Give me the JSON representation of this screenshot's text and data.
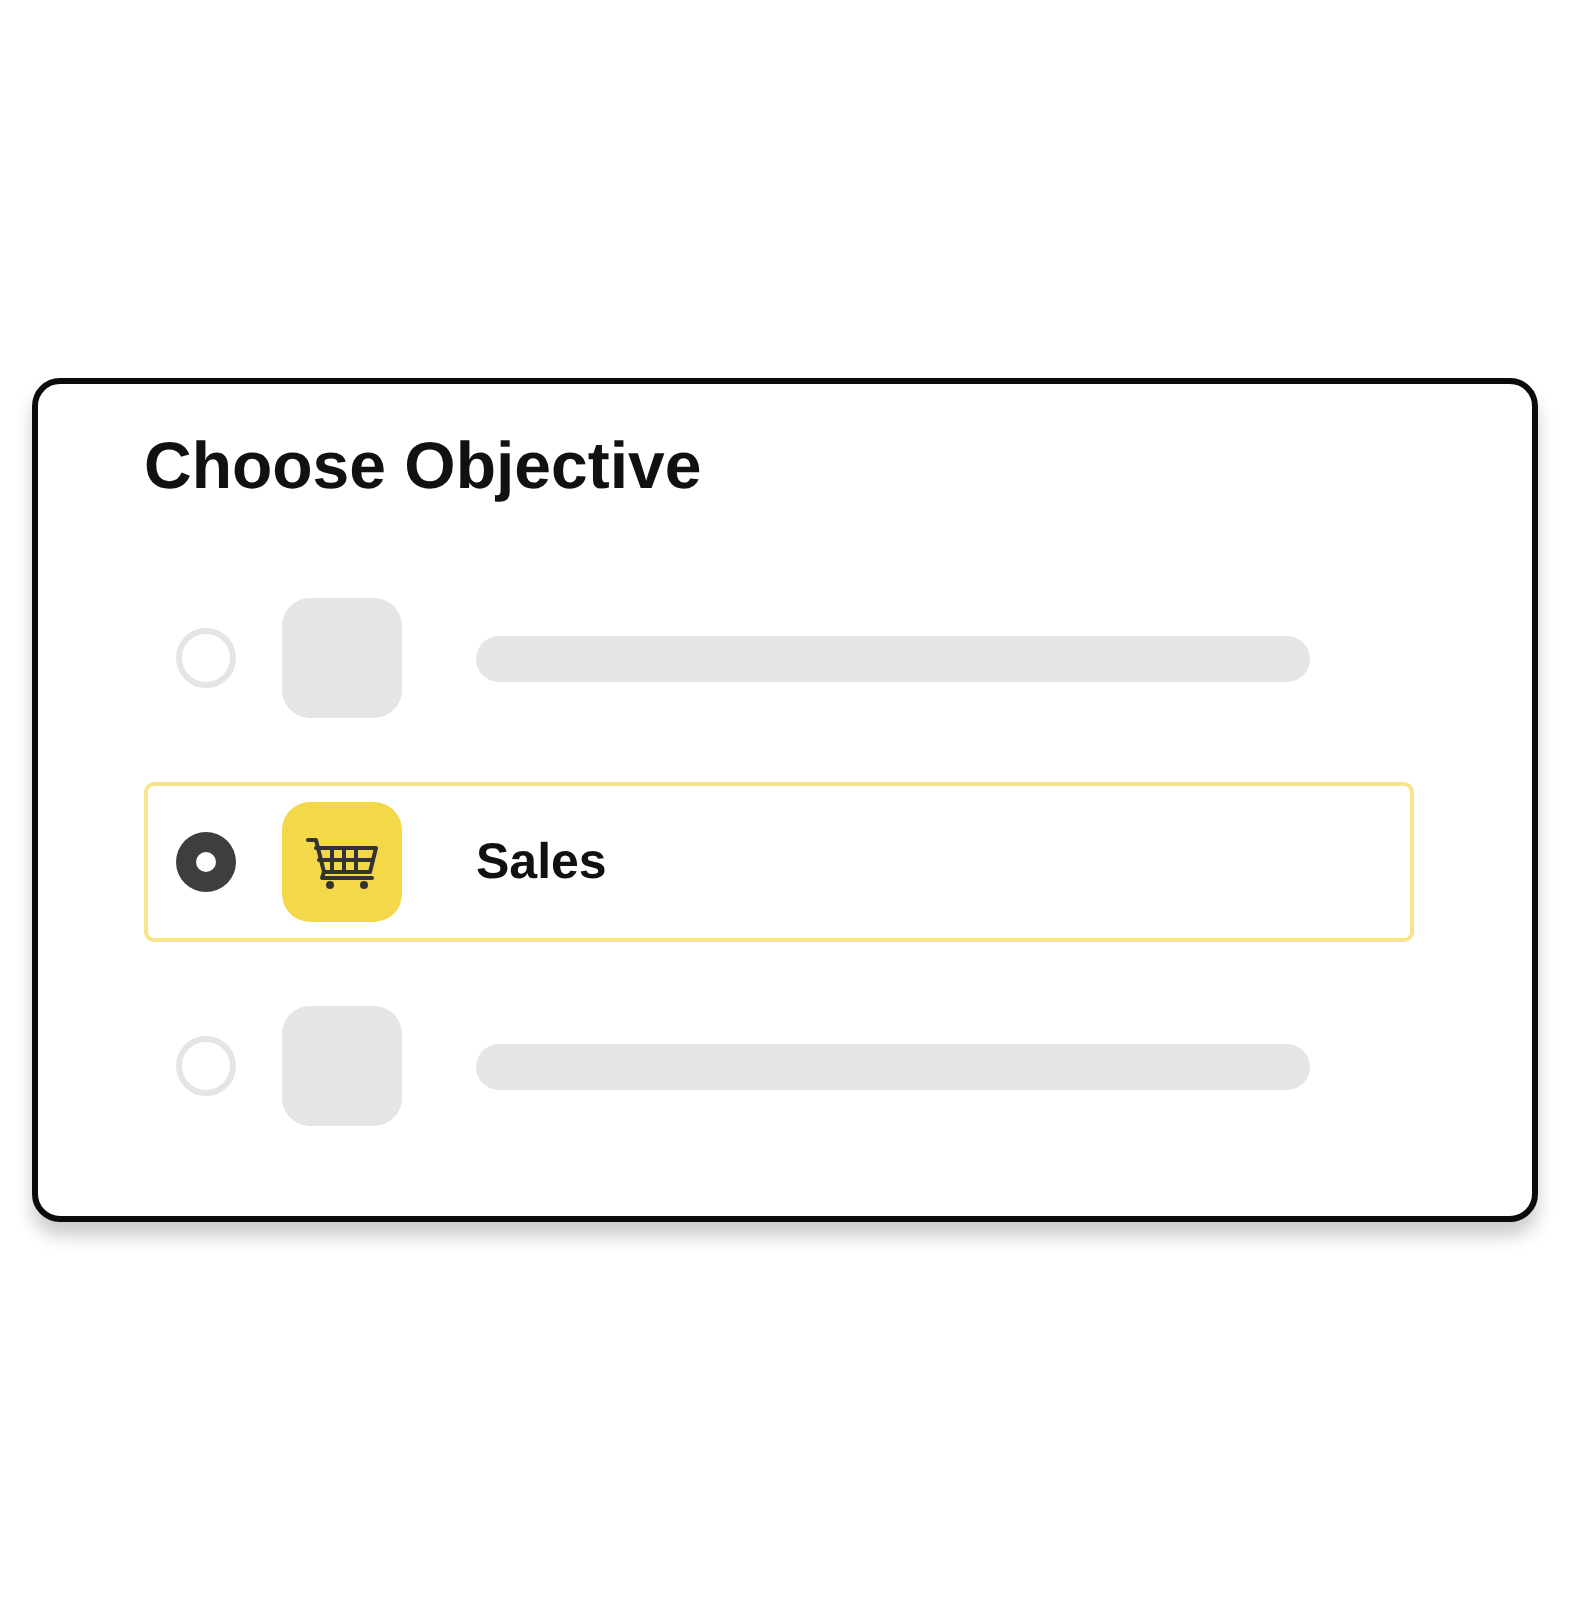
{
  "title": "Choose Objective",
  "options": [
    {
      "kind": "placeholder",
      "selected": false
    },
    {
      "kind": "objective",
      "label": "Sales",
      "selected": true
    },
    {
      "kind": "placeholder",
      "selected": false
    }
  ]
}
